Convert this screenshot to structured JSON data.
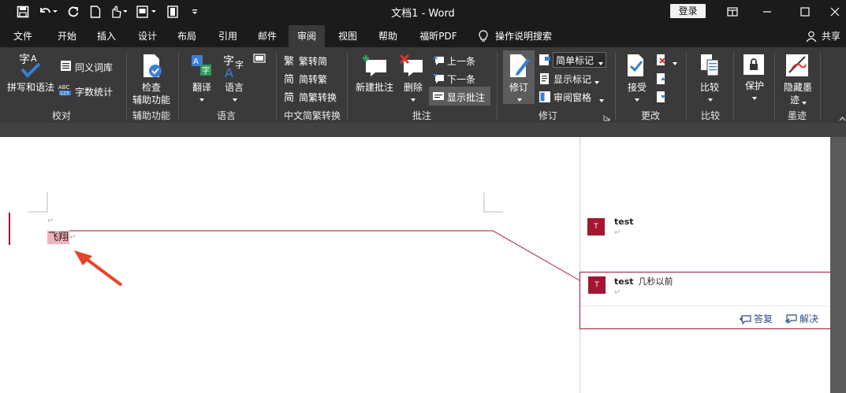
{
  "titlebar": {
    "doc_title": "文档1  -  Word",
    "login": "登录"
  },
  "tabs": [
    "文件",
    "开始",
    "插入",
    "设计",
    "布局",
    "引用",
    "邮件",
    "审阅",
    "视图",
    "帮助",
    "福昕PDF"
  ],
  "active_tab": "审阅",
  "tell_me": "操作说明搜索",
  "share": "共享",
  "ribbon": {
    "proofing": {
      "spell": "拼写和语法",
      "thesaurus": "同义词库",
      "wordcount": "字数统计",
      "group": "校对"
    },
    "accessibility": {
      "check": "检查",
      "check2": "辅助功能",
      "group": "辅助功能"
    },
    "language": {
      "translate": "翻译",
      "language": "语言",
      "group": "语言"
    },
    "chinese": {
      "t2s": "繁转简",
      "s2t": "简转繁",
      "convert": "简繁转换",
      "group": "中文简繁转换"
    },
    "comments": {
      "new": "新建批注",
      "delete": "删除",
      "prev": "上一条",
      "next": "下一条",
      "show": "显示批注",
      "group": "批注"
    },
    "tracking": {
      "track": "修订",
      "simple_markup": "简单标记",
      "show_markup": "显示标记",
      "review_pane": "审阅窗格",
      "group": "修订"
    },
    "changes": {
      "accept": "接受",
      "group": "更改"
    },
    "compare": {
      "compare": "比较",
      "group": "比较"
    },
    "protect": {
      "protect": "保护"
    },
    "ink": {
      "hide1": "隐藏墨",
      "hide2": "迹",
      "group": "墨迹"
    }
  },
  "document": {
    "commented_text": "飞翔",
    "para_mark": "↵"
  },
  "comments": [
    {
      "avatar": "T",
      "user": "test",
      "time": ""
    },
    {
      "avatar": "T",
      "user": "test",
      "time": "几秒以前"
    }
  ],
  "comment_actions": {
    "reply": "答复",
    "resolve": "解决"
  },
  "colors": {
    "accent": "#a31530",
    "highlight": "#f2b3bf",
    "arrow": "#e8412b",
    "link": "#2c4f86"
  }
}
